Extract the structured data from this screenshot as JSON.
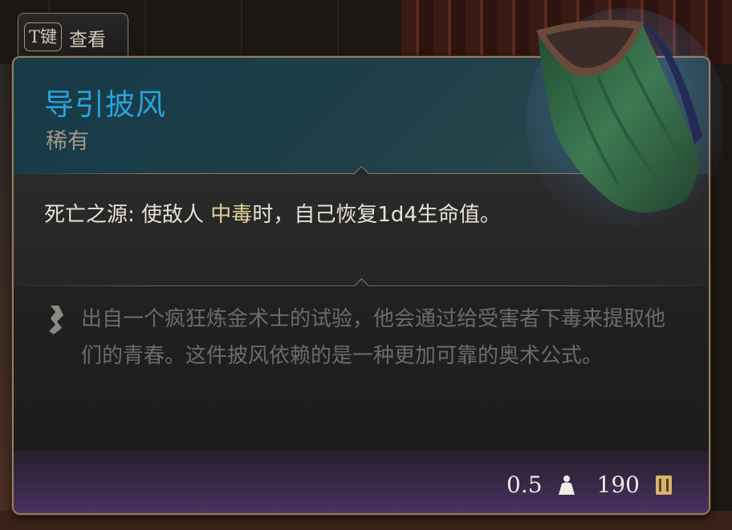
{
  "hint": {
    "key": "T键",
    "label": "查看"
  },
  "item": {
    "name": "导引披风",
    "rarity": "稀有",
    "effect": {
      "prefix": "死亡之源: 使敌人 ",
      "keyword": "中毒",
      "suffix": "时，自己恢复1d4生命值。"
    },
    "description": "出自一个疯狂炼金术士的试验，他会通过给受害者下毒来提取他们的青春。这件披风依赖的是一种更加可靠的奥术公式。",
    "weight": "0.5",
    "value": "190"
  },
  "icons": {
    "quote": "quote-glyph-icon",
    "weight": "weight-icon",
    "coin": "gold-coin-icon",
    "cloak": "cloak-item-icon"
  },
  "colors": {
    "name": "#2aa2da",
    "rarity": "#a2978a",
    "keyword": "#e2d29a",
    "description": "#6e6a66",
    "border": "#9a7c5a"
  }
}
